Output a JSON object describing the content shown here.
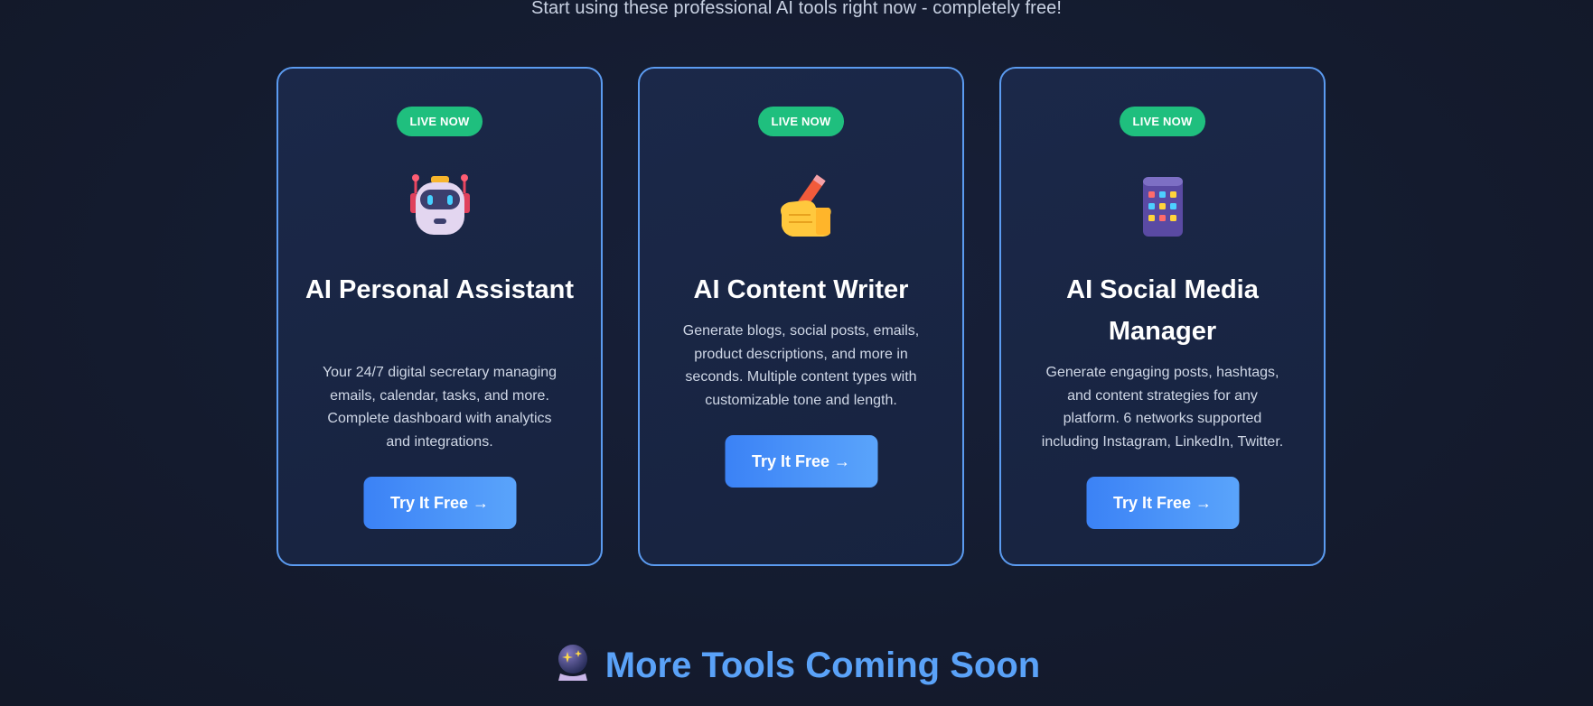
{
  "header": {
    "subtitle": "Start using these professional AI tools right now - completely free!"
  },
  "colors": {
    "accent": "#5b9bf0",
    "badge": "#1fbf7e",
    "button_start": "#3b82f6",
    "button_end": "#5aa4fb",
    "heading_blue": "#5aa2f8",
    "background": "#141b2e"
  },
  "tools": [
    {
      "badge": "LIVE NOW",
      "icon": "robot-icon",
      "title": "AI Personal Assistant",
      "description": "Your 24/7 digital secretary managing emails, calendar, tasks, and more. Complete dashboard with analytics and integrations.",
      "button": "Try It Free →"
    },
    {
      "badge": "LIVE NOW",
      "icon": "writing-hand-icon",
      "title": "AI Content Writer",
      "description": "Generate blogs, social posts, emails, product descriptions, and more in seconds. Multiple content types with customizable tone and length.",
      "button": "Try It Free →"
    },
    {
      "badge": "LIVE NOW",
      "icon": "mobile-apps-icon",
      "title": "AI Social Media Manager",
      "description": "Generate engaging posts, hashtags, and content strategies for any platform. 6 networks supported including Instagram, LinkedIn, Twitter.",
      "button": "Try It Free →"
    }
  ],
  "coming_soon": {
    "icon": "crystal-ball-icon",
    "heading": "More Tools Coming Soon"
  }
}
